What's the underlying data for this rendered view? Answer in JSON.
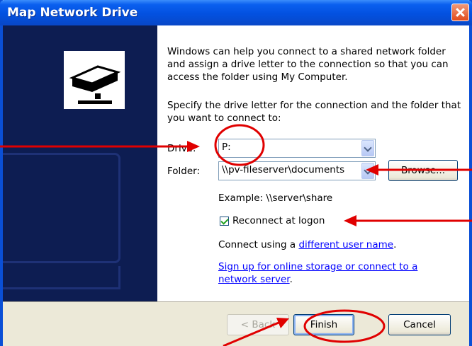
{
  "window": {
    "title": "Map Network Drive"
  },
  "intro": "Windows can help you connect to a shared network folder and assign a drive letter to the connection so that you can access the folder using My Computer.",
  "instruction": "Specify the drive letter for the connection and the folder that you want to connect to:",
  "drive": {
    "label": "Drive:",
    "value": "P:"
  },
  "folder": {
    "label": "Folder:",
    "value": "\\\\pv-fileserver\\documents",
    "browse_label": "Browse..."
  },
  "example": "Example: \\\\server\\share",
  "reconnect": {
    "label": "Reconnect at logon",
    "checked": true
  },
  "connect_using": {
    "prefix": "Connect using a ",
    "link": "different user name",
    "suffix": "."
  },
  "signup": {
    "link": "Sign up for online storage or connect to a network server",
    "suffix": "."
  },
  "buttons": {
    "back": "< Back",
    "finish": "Finish",
    "cancel": "Cancel"
  },
  "colors": {
    "titlebar": "#0a5fef",
    "left_panel": "#0d1d52",
    "annotation": "#e00000"
  }
}
